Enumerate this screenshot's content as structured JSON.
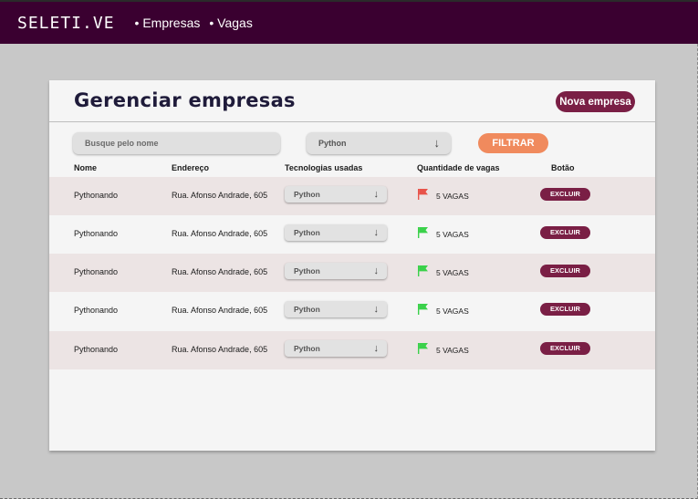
{
  "header": {
    "brand": "SELETI.VE",
    "nav": [
      "Empresas",
      "Vagas"
    ]
  },
  "page": {
    "title": "Gerenciar empresas",
    "new_button": "Nova empresa"
  },
  "filters": {
    "search_placeholder": "Busque pelo nome",
    "tech_select": "Python",
    "filter_button": "FILTRAR"
  },
  "table": {
    "headers": {
      "name": "Nome",
      "address": "Endereço",
      "tech": "Tecnologias usadas",
      "jobs": "Quantidade de vagas",
      "action": "Botão"
    },
    "rows": [
      {
        "name": "Pythonando",
        "address": "Rua. Afonso Andrade, 605",
        "tech": "Python",
        "jobs": "5 VAGAS",
        "flag_color": "#e8534a",
        "delete": "EXCLUIR"
      },
      {
        "name": "Pythonando",
        "address": "Rua. Afonso Andrade, 605",
        "tech": "Python",
        "jobs": "5 VAGAS",
        "flag_color": "#3ad14a",
        "delete": "EXCLUIR"
      },
      {
        "name": "Pythonando",
        "address": "Rua. Afonso Andrade, 605",
        "tech": "Python",
        "jobs": "5 VAGAS",
        "flag_color": "#3ad14a",
        "delete": "EXCLUIR"
      },
      {
        "name": "Pythonando",
        "address": "Rua. Afonso Andrade, 605",
        "tech": "Python",
        "jobs": "5 VAGAS",
        "flag_color": "#3ad14a",
        "delete": "EXCLUIR"
      },
      {
        "name": "Pythonando",
        "address": "Rua. Afonso Andrade, 605",
        "tech": "Python",
        "jobs": "5 VAGAS",
        "flag_color": "#3ad14a",
        "delete": "EXCLUIR"
      }
    ]
  },
  "icons": {
    "dropdown": "arrow-down-icon",
    "flag": "flag-icon"
  },
  "colors": {
    "topbar": "#3a0030",
    "primary_button": "#7a1f45",
    "filter_button": "#f08a5d",
    "flag_red": "#e8534a",
    "flag_green": "#3ad14a"
  }
}
